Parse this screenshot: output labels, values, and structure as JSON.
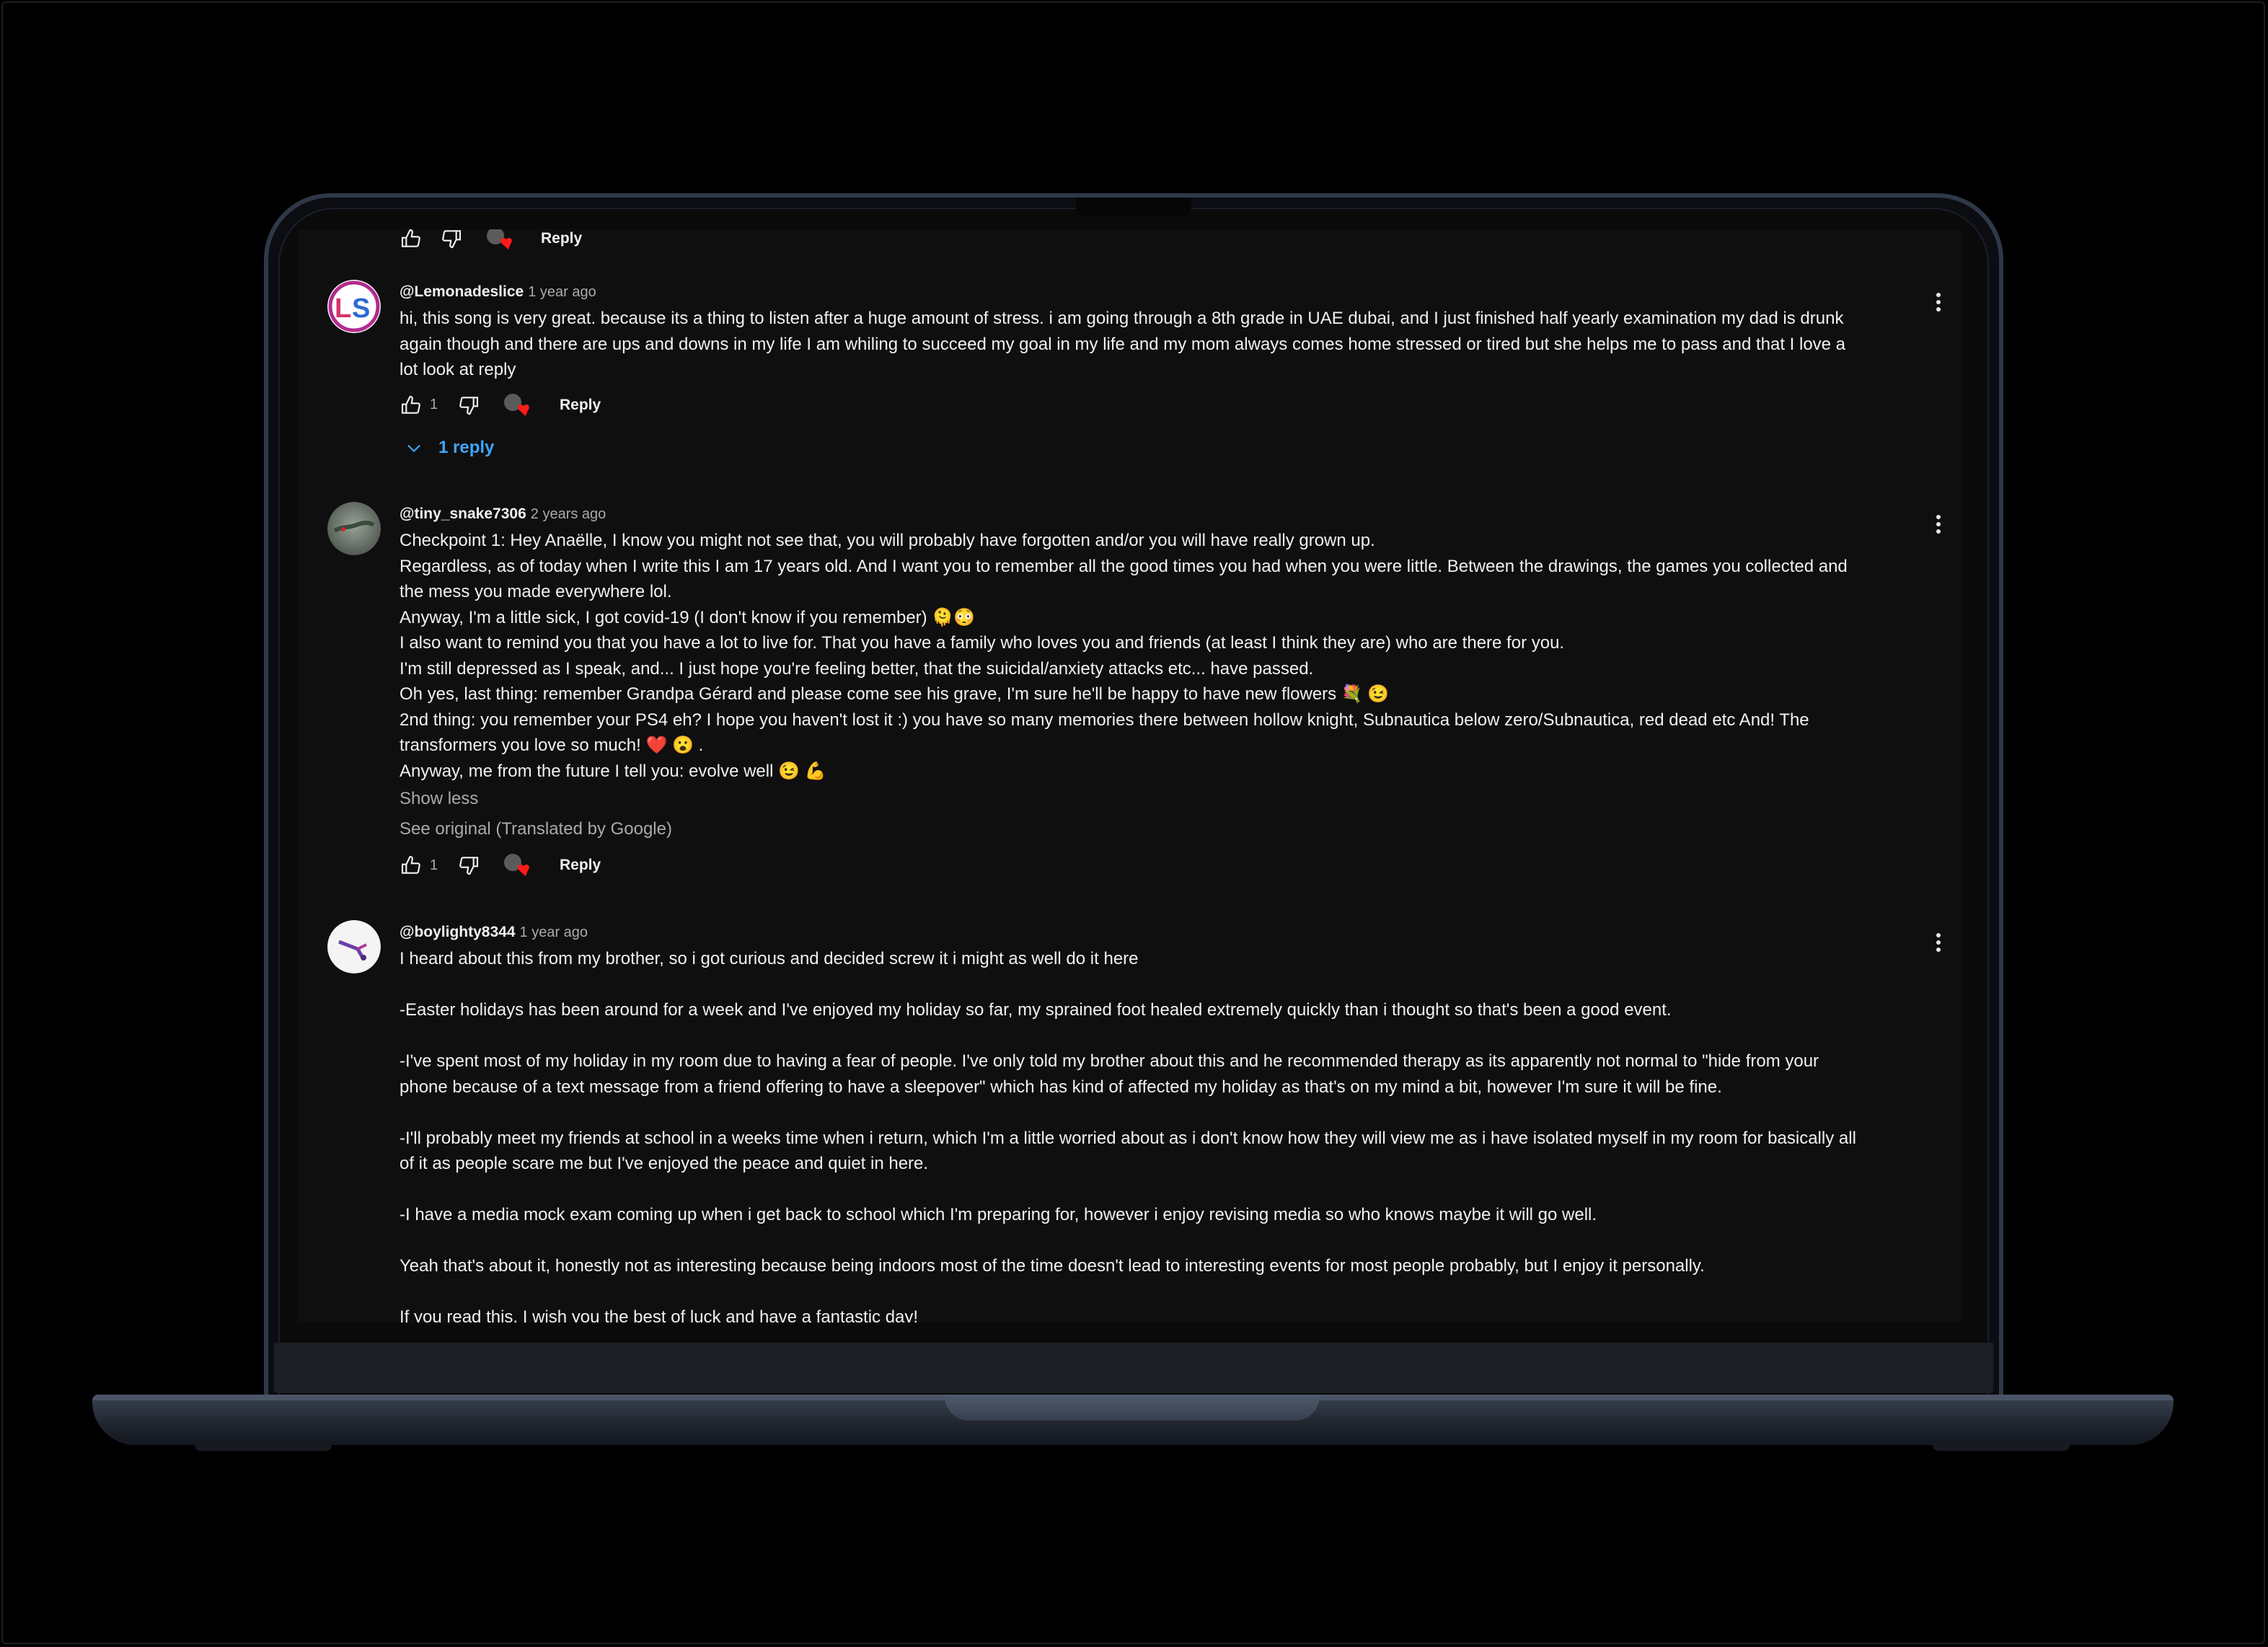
{
  "top_partial_actions": {
    "reply_label": "Reply"
  },
  "comments": [
    {
      "author": "@Lemonadeslice",
      "time": "1 year ago",
      "lines": [
        "hi, this song is very great. because its a thing to listen after a huge amount of stress. i am going through a 8th grade in UAE dubai, and I just finished half yearly examination my dad is drunk",
        "again though and there are ups and downs in my life I am whiling to succeed my goal in my life and my mom always comes home stressed or tired but she helps me to pass and that I love a",
        "lot look at reply"
      ],
      "likes": "1",
      "reply_label": "Reply",
      "replies_label": "1 reply"
    },
    {
      "author": "@tiny_snake7306",
      "time": "2 years ago",
      "lines": [
        "Checkpoint 1: Hey Anaëlle, I know you might not see that, you will probably have forgotten and/or you will have really grown up.",
        "Regardless, as of today when I write this I am 17 years old. And I want you to remember all the good times you had when you were little. Between the drawings, the games you collected and",
        "the mess you made everywhere lol.",
        "Anyway, I'm a little sick, I got covid-19 (I don't know if you remember) 🫠😳",
        "I also want to remind you that you have a lot to live for. That you have a family who loves you and friends (at least I think they are) who are there for you.",
        "I'm still depressed as I speak, and... I just hope you're feeling better, that the suicidal/anxiety attacks etc... have passed.",
        "Oh yes, last thing: remember Grandpa Gérard and please come see his grave, I'm sure he'll be happy to have new flowers 💐 😉",
        "2nd thing: you remember your PS4 eh? I hope you haven't lost it :) you have so many memories there between hollow knight, Subnautica below zero/Subnautica, red dead etc And! The",
        "transformers you love so much! ❤️ 😮 .",
        "Anyway, me from the future I tell you: evolve well 😉 💪"
      ],
      "show_less": "Show less",
      "see_original": "See original (Translated by Google)",
      "likes": "1",
      "reply_label": "Reply"
    },
    {
      "author": "@boylighty8344",
      "time": "1 year ago",
      "lines": [
        "I heard about this from my brother, so i got curious and decided screw it i might as well do it here",
        "",
        "-Easter holidays has been around for a week and I've enjoyed my holiday so far, my sprained foot healed extremely quickly than i thought so that's been a good event.",
        "",
        "-I've spent most of my holiday in my room due to having a fear of people. I've only told my brother about this and he recommended therapy as its apparently not normal to \"hide from your",
        "phone because of a text message from a friend offering to have a sleepover\" which has kind of affected my holiday as that's on my mind a bit, however I'm sure it will be fine.",
        "",
        "-I'll probably meet my friends at school in a weeks time when i return, which I'm a little worried about as i don't know how they will view me as i have isolated myself in my room for basically all",
        "of it as people scare me but I've enjoyed the peace and quiet in here.",
        "",
        "-I have a media mock exam coming up when i get back to school which I'm preparing for, however i enjoy revising media so who knows maybe it will go well.",
        "",
        "Yeah that's about it, honestly not as interesting because being indoors most of the time doesn't lead to interesting events for most people probably, but I enjoy it personally.",
        "",
        "If you read this, I wish you the best of luck and have a fantastic day!"
      ]
    }
  ]
}
